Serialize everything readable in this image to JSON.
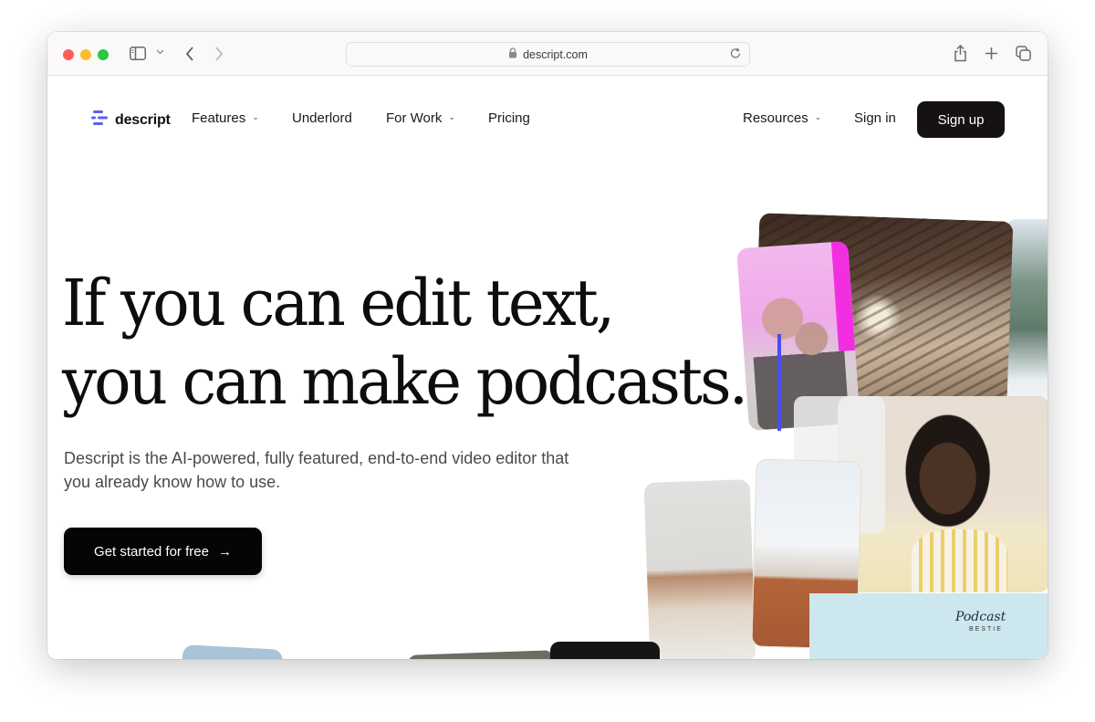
{
  "browser": {
    "url": "descript.com",
    "icons": [
      "sidebar-icon",
      "chevron-down-icon",
      "back-icon",
      "forward-icon",
      "lock-icon",
      "reload-icon",
      "share-icon",
      "new-tab-icon",
      "tabs-overview-icon"
    ]
  },
  "nav": {
    "logo_text": "descript",
    "items": [
      {
        "label": "Features",
        "has_dropdown": true
      },
      {
        "label": "Underlord",
        "has_dropdown": false
      },
      {
        "label": "For Work",
        "has_dropdown": true
      },
      {
        "label": "Pricing",
        "has_dropdown": false
      }
    ],
    "resources_label": "Resources",
    "sign_in_label": "Sign in",
    "sign_up_label": "Sign up",
    "chevron_glyph": "⌄"
  },
  "hero": {
    "headline_line1": "If you can edit text,",
    "headline_line2": "you can make podcasts.",
    "subtext": "Descript is the AI-powered, fully featured, end-to-end video editor that you already know how to use.",
    "cta_label": "Get started for free",
    "cta_arrow": "→",
    "accent_color": "#4a4ef0"
  },
  "collage": {
    "podcast_logo_text": "Podcast",
    "podcast_logo_sub": "BESTIE"
  }
}
